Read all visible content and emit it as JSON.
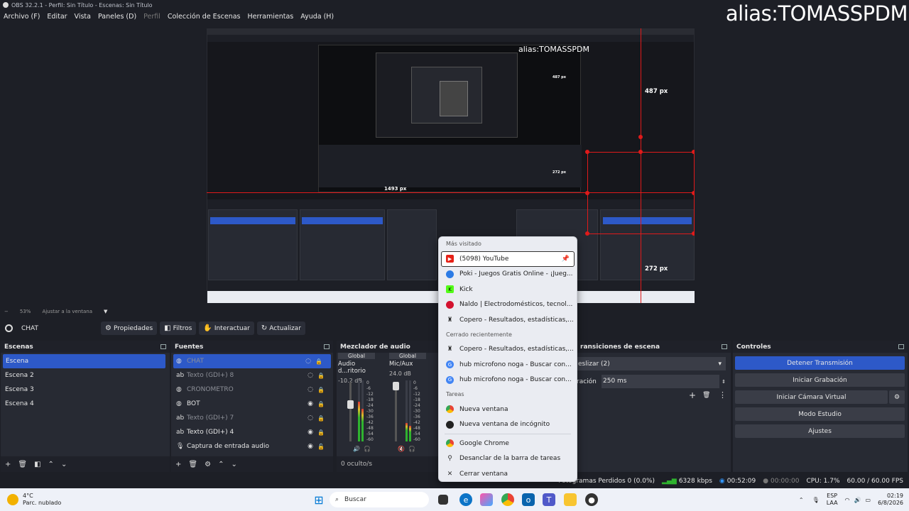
{
  "window": {
    "title": "OBS 32.2.1 - Perfil: Sin Título - Escenas: Sin Título",
    "alias": "alias:TOMASSPDM"
  },
  "menu": [
    "Archivo (F)",
    "Editar",
    "Vista",
    "Paneles (D)",
    "Perfil",
    "Colección de Escenas",
    "Herramientas",
    "Ayuda (H)"
  ],
  "preview": {
    "measure_top": "487 px",
    "measure_bottom": "272 px",
    "measure_left": "1493 px",
    "nested_measure_top": "487 px",
    "nested_measure_bottom": "272 px",
    "nested_alias": "alias:TOMASSPDM"
  },
  "zoom": {
    "level": "53%",
    "fit": "Ajustar a la ventana"
  },
  "source_bar": {
    "current": "CHAT",
    "buttons": [
      "Propiedades",
      "Filtros",
      "Interactuar",
      "Actualizar"
    ]
  },
  "scenes": {
    "title": "Escenas",
    "items": [
      "Escena",
      "Escena 2",
      "Escena 3",
      "Escena 4"
    ]
  },
  "sources": {
    "title": "Fuentes",
    "items": [
      {
        "name": "CHAT",
        "icon": "globe-icon",
        "glyph": "◍"
      },
      {
        "name": "Texto (GDI+) 8",
        "icon": "text-icon",
        "glyph": "ab"
      },
      {
        "name": "CRONOMETRO",
        "icon": "globe-icon",
        "glyph": "◍"
      },
      {
        "name": "BOT",
        "icon": "globe-icon",
        "glyph": "◍"
      },
      {
        "name": "Texto (GDI+) 7",
        "icon": "text-icon",
        "glyph": "ab"
      },
      {
        "name": "Texto (GDI+) 4",
        "icon": "text-icon",
        "glyph": "ab"
      },
      {
        "name": "Captura de entrada audio",
        "icon": "microphone-icon",
        "glyph": "🎙"
      }
    ]
  },
  "mixer": {
    "title": "Mezclador de audio",
    "channels": [
      {
        "group": "Global",
        "name": "Audio d...ritorio",
        "db": "-10.2 dB"
      },
      {
        "group": "Global",
        "name": "Mic/Aux",
        "db": "24.0 dB"
      }
    ],
    "hidden": "0 oculto/s",
    "scale": [
      "0",
      "-6",
      "-12",
      "-18",
      "-24",
      "-30",
      "-36",
      "-42",
      "-48",
      "-54",
      "-60"
    ]
  },
  "transitions": {
    "title": "ransiciones de escena",
    "type": "eslizar (2)",
    "duration_label": "ración",
    "duration_value": "250 ms"
  },
  "controls": {
    "title": "Controles",
    "buttons": [
      "Detener Transmisión",
      "Iniciar Grabación",
      "Iniciar Cámara Virtual",
      "Modo Estudio",
      "Ajustes"
    ]
  },
  "status": {
    "dropped": "Fotogramas Perdidos 0 (0.0%)",
    "bitrate": "6328 kbps",
    "stream_time": "00:52:09",
    "rec_time": "00:00:00",
    "cpu": "CPU: 1.7%",
    "fps": "60.00 / 60.00 FPS"
  },
  "jumplist": {
    "most_visited_label": "Más visitado",
    "most_visited": [
      {
        "label": "(5098) YouTube",
        "color": "#e62117",
        "glyph": "▶",
        "icon": "youtube-icon"
      },
      {
        "label": "Poki - Juegos Gratis Online - ¡Jueg...",
        "color": "#2c7be5",
        "glyph": "◯",
        "icon": "poki-icon"
      },
      {
        "label": "Kick",
        "color": "#53fc18",
        "glyph": "K",
        "icon": "kick-icon"
      },
      {
        "label": "Naldo | Electrodomésticos, tecnol...",
        "color": "#d3122f",
        "glyph": "●",
        "icon": "naldo-icon"
      },
      {
        "label": "Copero - Resultados, estadísticas,...",
        "color": "#444",
        "glyph": "♜",
        "icon": "copero-icon"
      }
    ],
    "recent_label": "Cerrado recientemente",
    "recent": [
      {
        "label": "Copero - Resultados, estadísticas,...",
        "color": "#444",
        "glyph": "♜",
        "icon": "copero-icon"
      },
      {
        "label": "hub microfono noga - Buscar con...",
        "color": "#4285f4",
        "glyph": "G",
        "icon": "google-icon"
      },
      {
        "label": "hub microfono noga - Buscar con...",
        "color": "#4285f4",
        "glyph": "G",
        "icon": "google-icon"
      }
    ],
    "tasks_label": "Tareas",
    "tasks": [
      {
        "label": "Nueva ventana",
        "color": "#34a853",
        "glyph": "◉",
        "icon": "chrome-icon"
      },
      {
        "label": "Nueva ventana de incógnito",
        "color": "#222",
        "glyph": "◉",
        "icon": "incognito-icon"
      }
    ],
    "app": [
      {
        "label": "Google Chrome",
        "color": "#34a853",
        "glyph": "◉",
        "icon": "chrome-icon"
      },
      {
        "label": "Desanclar de la barra de tareas",
        "color": "transparent",
        "glyph": "⚲",
        "icon": "unpin-icon"
      },
      {
        "label": "Cerrar ventana",
        "color": "transparent",
        "glyph": "✕",
        "icon": "close-icon"
      }
    ]
  },
  "taskbar": {
    "temp": "4°C",
    "weather": "Parc. nublado",
    "search": "Buscar",
    "lang": "ESP",
    "lang2": "LAA",
    "time": "02:19",
    "date": "6/8/2026"
  }
}
